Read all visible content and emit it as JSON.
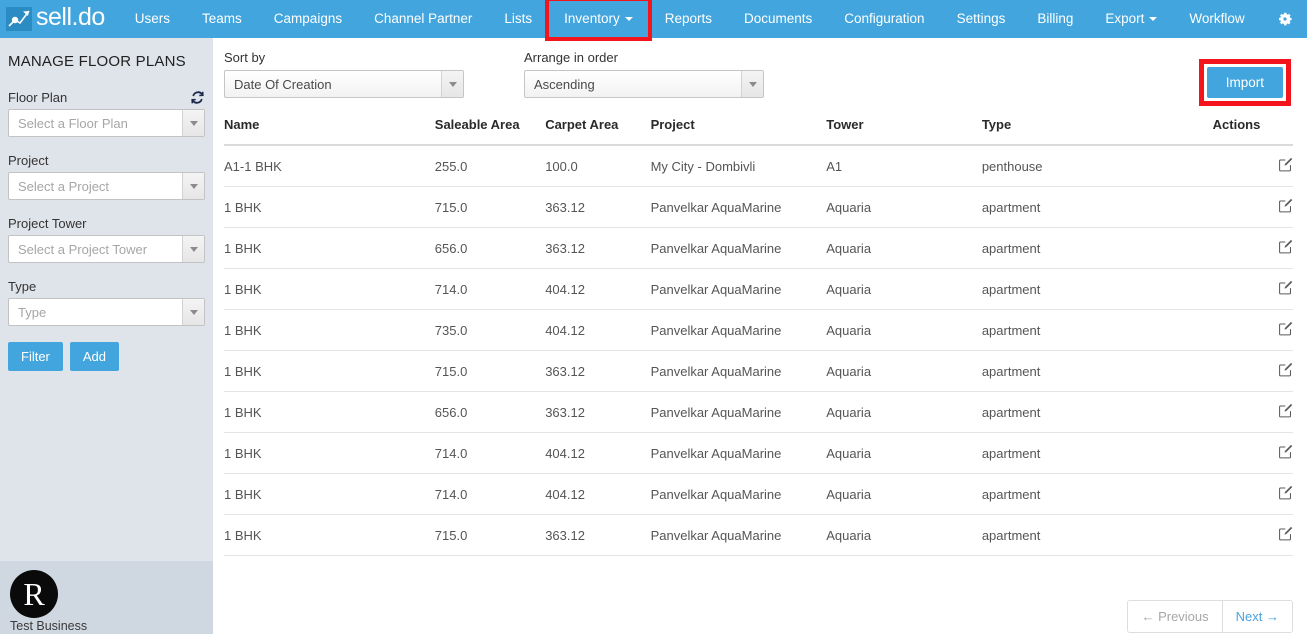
{
  "navbar": {
    "brand": "sell.do",
    "brand_icon": "chart-arrow-icon",
    "items": [
      {
        "label": "Users",
        "has_caret": false,
        "highlighted": false
      },
      {
        "label": "Teams",
        "has_caret": false,
        "highlighted": false
      },
      {
        "label": "Campaigns",
        "has_caret": false,
        "highlighted": false
      },
      {
        "label": "Channel Partner",
        "has_caret": false,
        "highlighted": false
      },
      {
        "label": "Lists",
        "has_caret": false,
        "highlighted": false
      },
      {
        "label": "Inventory",
        "has_caret": true,
        "highlighted": true
      },
      {
        "label": "Reports",
        "has_caret": false,
        "highlighted": false
      },
      {
        "label": "Documents",
        "has_caret": false,
        "highlighted": false
      },
      {
        "label": "Configuration",
        "has_caret": false,
        "highlighted": false
      },
      {
        "label": "Settings",
        "has_caret": false,
        "highlighted": false
      },
      {
        "label": "Billing",
        "has_caret": false,
        "highlighted": false
      },
      {
        "label": "Export",
        "has_caret": true,
        "highlighted": false
      },
      {
        "label": "Workflow",
        "has_caret": false,
        "highlighted": false
      }
    ],
    "settings_icon": "gear-icon",
    "background_color": "#42a5dd",
    "highlight_color": "#f4141b"
  },
  "sidebar": {
    "title": "MANAGE FLOOR PLANS",
    "refresh_icon": "refresh-icon",
    "fields": [
      {
        "label": "Floor Plan",
        "placeholder": "Select a Floor Plan",
        "value": ""
      },
      {
        "label": "Project",
        "placeholder": "Select a Project",
        "value": ""
      },
      {
        "label": "Project Tower",
        "placeholder": "Select a Project Tower",
        "value": ""
      },
      {
        "label": "Type",
        "placeholder": "Type",
        "value": ""
      }
    ],
    "filter_label": "Filter",
    "add_label": "Add",
    "business": {
      "logo_letter": "R",
      "name": "Test Business"
    }
  },
  "main": {
    "sort_by": {
      "label": "Sort by",
      "value": "Date Of Creation"
    },
    "arrange_order": {
      "label": "Arrange in order",
      "value": "Ascending"
    },
    "import_label": "Import",
    "table": {
      "columns": [
        "Name",
        "Saleable Area",
        "Carpet Area",
        "Project",
        "Tower",
        "Type",
        "Actions"
      ],
      "rows": [
        {
          "name": "A1-1 BHK",
          "saleable_area": "255.0",
          "carpet_area": "100.0",
          "project": "My City - Dombivli",
          "tower": "A1",
          "type": "penthouse",
          "action_icon": "edit-icon"
        },
        {
          "name": "1 BHK",
          "saleable_area": "715.0",
          "carpet_area": "363.12",
          "project": "Panvelkar AquaMarine",
          "tower": "Aquaria",
          "type": "apartment",
          "action_icon": "edit-icon"
        },
        {
          "name": "1 BHK",
          "saleable_area": "656.0",
          "carpet_area": "363.12",
          "project": "Panvelkar AquaMarine",
          "tower": "Aquaria",
          "type": "apartment",
          "action_icon": "edit-icon"
        },
        {
          "name": "1 BHK",
          "saleable_area": "714.0",
          "carpet_area": "404.12",
          "project": "Panvelkar AquaMarine",
          "tower": "Aquaria",
          "type": "apartment",
          "action_icon": "edit-icon"
        },
        {
          "name": "1 BHK",
          "saleable_area": "735.0",
          "carpet_area": "404.12",
          "project": "Panvelkar AquaMarine",
          "tower": "Aquaria",
          "type": "apartment",
          "action_icon": "edit-icon"
        },
        {
          "name": "1 BHK",
          "saleable_area": "715.0",
          "carpet_area": "363.12",
          "project": "Panvelkar AquaMarine",
          "tower": "Aquaria",
          "type": "apartment",
          "action_icon": "edit-icon"
        },
        {
          "name": "1 BHK",
          "saleable_area": "656.0",
          "carpet_area": "363.12",
          "project": "Panvelkar AquaMarine",
          "tower": "Aquaria",
          "type": "apartment",
          "action_icon": "edit-icon"
        },
        {
          "name": "1 BHK",
          "saleable_area": "714.0",
          "carpet_area": "404.12",
          "project": "Panvelkar AquaMarine",
          "tower": "Aquaria",
          "type": "apartment",
          "action_icon": "edit-icon"
        },
        {
          "name": "1 BHK",
          "saleable_area": "714.0",
          "carpet_area": "404.12",
          "project": "Panvelkar AquaMarine",
          "tower": "Aquaria",
          "type": "apartment",
          "action_icon": "edit-icon"
        },
        {
          "name": "1 BHK",
          "saleable_area": "715.0",
          "carpet_area": "363.12",
          "project": "Panvelkar AquaMarine",
          "tower": "Aquaria",
          "type": "apartment",
          "action_icon": "edit-icon"
        }
      ]
    },
    "pagination": {
      "previous_label": "← Previous",
      "next_label": "Next →"
    }
  }
}
